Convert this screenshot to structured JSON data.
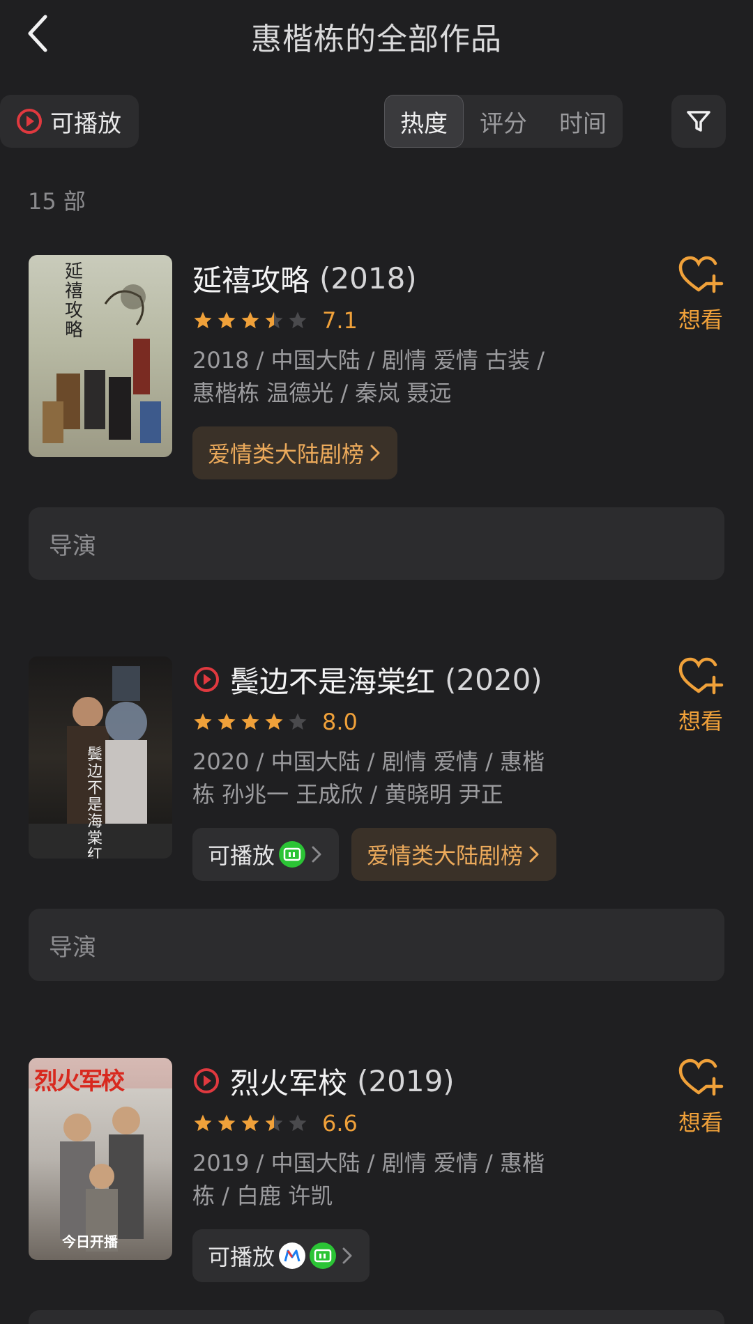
{
  "header": {
    "title": "惠楷栋的全部作品"
  },
  "filters": {
    "playable_label": "可播放",
    "sort_tabs": [
      "热度",
      "评分",
      "时间"
    ]
  },
  "count": "15 部",
  "works": [
    {
      "title": "延禧攻略",
      "year": "(2018)",
      "rating": 7.1,
      "score": "7.1",
      "meta_line1": "2018 / 中国大陆 / 剧情 爱情 古装 /",
      "meta_line2": "惠楷栋 温德光 / 秦岚 聂远",
      "rank_chip": "爱情类大陆剧榜",
      "want": "想看",
      "director": "导演",
      "poster_text": "延禧攻略"
    },
    {
      "title": "鬓边不是海棠红",
      "year": "(2020)",
      "rating": 8.0,
      "score": "8.0",
      "meta_line1": "2020 / 中国大陆 / 剧情 爱情 / 惠楷",
      "meta_line2": "栋 孙兆一 王成欣 / 黄晓明 尹正",
      "play_chip": "可播放",
      "rank_chip": "爱情类大陆剧榜",
      "want": "想看",
      "director": "导演",
      "poster_text": "鬓边不是海棠红"
    },
    {
      "title": "烈火军校",
      "year": "(2019)",
      "rating": 6.6,
      "score": "6.6",
      "meta_line1": "2019 / 中国大陆 / 剧情 爱情 / 惠楷",
      "meta_line2": "栋 / 白鹿 许凯",
      "play_chip": "可播放",
      "want": "想看",
      "poster_text": "烈火军校",
      "poster_badge": "今日开播"
    }
  ],
  "colors": {
    "accent": "#f0a13a",
    "play_red": "#e0393f",
    "iqiyi_green": "#2bc435"
  }
}
